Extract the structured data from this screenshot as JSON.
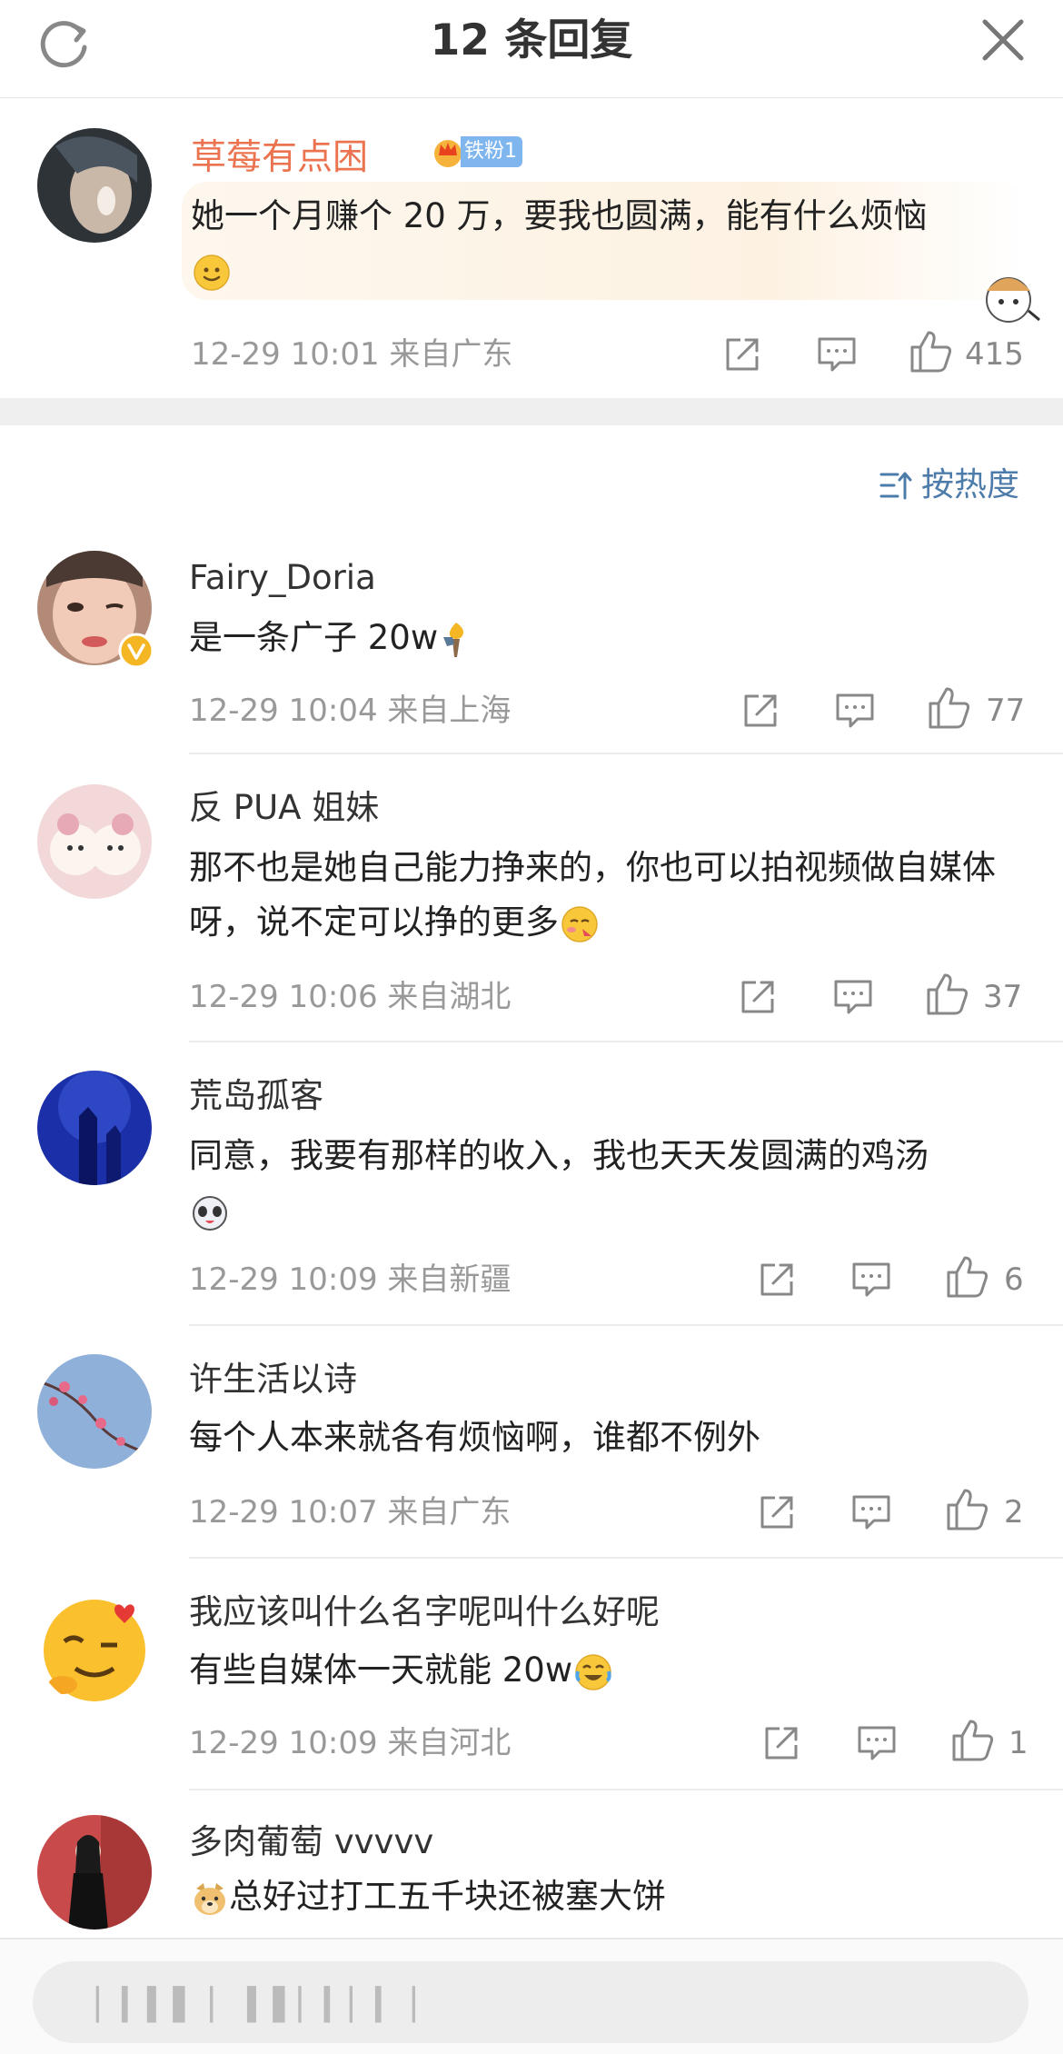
{
  "header": {
    "title": "12 条回复"
  },
  "root": {
    "username": "草莓有点困",
    "badge": "铁粉1",
    "text": "她一个月赚个 20 万，要我也圆满，能有什么烦恼",
    "meta": "12-29 10:01  来自广东",
    "likes": "415"
  },
  "sort": {
    "label": "按热度"
  },
  "replies": [
    {
      "username": "Fairy_Doria",
      "text": "是一条广子 20w",
      "meta": "12-29 10:04  来自上海",
      "likes": "77",
      "emoji": "torch"
    },
    {
      "username": "反 PUA 姐妹",
      "text": "那不也是她自己能力挣来的，你也可以拍视频做自媒体呀，说不定可以挣的更多",
      "meta": "12-29 10:06  来自湖北",
      "likes": "37",
      "emoji": "blush"
    },
    {
      "username": "荒岛孤客",
      "text": "同意，我要有那样的收入，我也天天发圆满的鸡汤",
      "meta": "12-29 10:09  来自新疆",
      "likes": "6",
      "emoji": "dog"
    },
    {
      "username": "许生活以诗",
      "text": "每个人本来就各有烦恼啊，谁都不例外",
      "meta": "12-29 10:07  来自广东",
      "likes": "2"
    },
    {
      "username": "我应该叫什么名字呢叫什么好呢",
      "text": "有些自媒体一天就能 20w",
      "meta": "12-29 10:09  来自河北",
      "likes": "1",
      "emoji": "laugh-cry"
    },
    {
      "username": "多肉葡萄 vvvvv",
      "text": "总好过打工五千块还被塞大饼",
      "emoji": "doge"
    }
  ],
  "composer": {
    "placeholder": "▏▎▍▌ ▏ ▍▌▏▎▏▎ ▏"
  },
  "colors": {
    "accent": "#eb7350",
    "link": "#4d7cab",
    "meta": "#999999"
  }
}
